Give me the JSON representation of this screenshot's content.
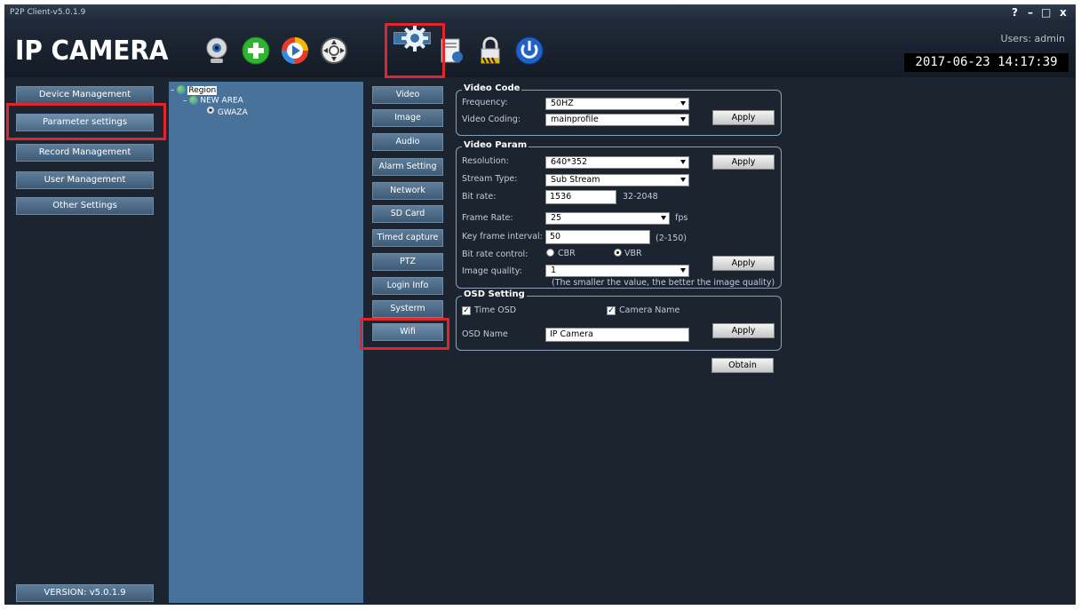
{
  "window": {
    "title": "P2P Client-v5.0.1.9",
    "controls": {
      "help": "?",
      "minimize": "–",
      "maximize": "□",
      "close": "x"
    }
  },
  "header": {
    "logo": "IP CAMERA",
    "users": "Users: admin",
    "datetime": "2017-06-23  14:17:39",
    "toolbar": [
      {
        "icon": "webcam-icon"
      },
      {
        "icon": "add-device-icon"
      },
      {
        "icon": "playback-icon"
      },
      {
        "icon": "ptz-control-icon"
      },
      {
        "icon": "gear-icon",
        "selected": true
      },
      {
        "icon": "record-icon"
      },
      {
        "icon": "lock-icon"
      },
      {
        "icon": "power-icon"
      }
    ]
  },
  "sidebar": {
    "items": [
      {
        "label": "Device Management"
      },
      {
        "label": "Parameter settings",
        "active": true
      },
      {
        "label": "Record Management"
      },
      {
        "label": "User Management"
      },
      {
        "label": "Other Settings"
      }
    ],
    "version": "VERSION: v5.0.1.9"
  },
  "tree": {
    "root": "Region",
    "area": "NEW AREA",
    "device": "GWAZA",
    "expand_root": "–",
    "expand_area": "–"
  },
  "tabs": [
    {
      "label": "Video"
    },
    {
      "label": "Image"
    },
    {
      "label": "Audio"
    },
    {
      "label": "Alarm Setting"
    },
    {
      "label": "Network"
    },
    {
      "label": "SD Card"
    },
    {
      "label": "Timed capture"
    },
    {
      "label": "PTZ"
    },
    {
      "label": "Login Info"
    },
    {
      "label": "Systerm"
    },
    {
      "label": "Wifi",
      "active": true
    }
  ],
  "video_code": {
    "title": "Video Code",
    "frequency_label": "Frequency:",
    "frequency_value": "50HZ",
    "coding_label": "Video Coding:",
    "coding_value": "mainprofile",
    "apply": "Apply"
  },
  "video_param": {
    "title": "Video Param",
    "resolution_label": "Resolution:",
    "resolution_value": "640*352",
    "stream_label": "Stream Type:",
    "stream_value": "Sub Stream",
    "bitrate_label": "Bit rate:",
    "bitrate_value": "1536",
    "bitrate_range": "32-2048",
    "framerate_label": "Frame Rate:",
    "framerate_value": "25",
    "framerate_unit": "fps",
    "keyframe_label": "Key frame interval:",
    "keyframe_value": "50",
    "keyframe_range": "(2-150)",
    "ratecontrol_label": "Bit rate control:",
    "cbr": "CBR",
    "vbr": "VBR",
    "quality_label": "Image quality:",
    "quality_value": "1",
    "quality_note": "(The smaller the value, the better the image quality)",
    "apply1": "Apply",
    "apply2": "Apply"
  },
  "osd": {
    "title": "OSD Setting",
    "time_osd": "Time OSD",
    "camera_name": "Camera Name",
    "check_mark": "✓",
    "name_label": "OSD Name",
    "name_value": "IP Camera",
    "apply": "Apply",
    "obtain": "Obtain"
  }
}
